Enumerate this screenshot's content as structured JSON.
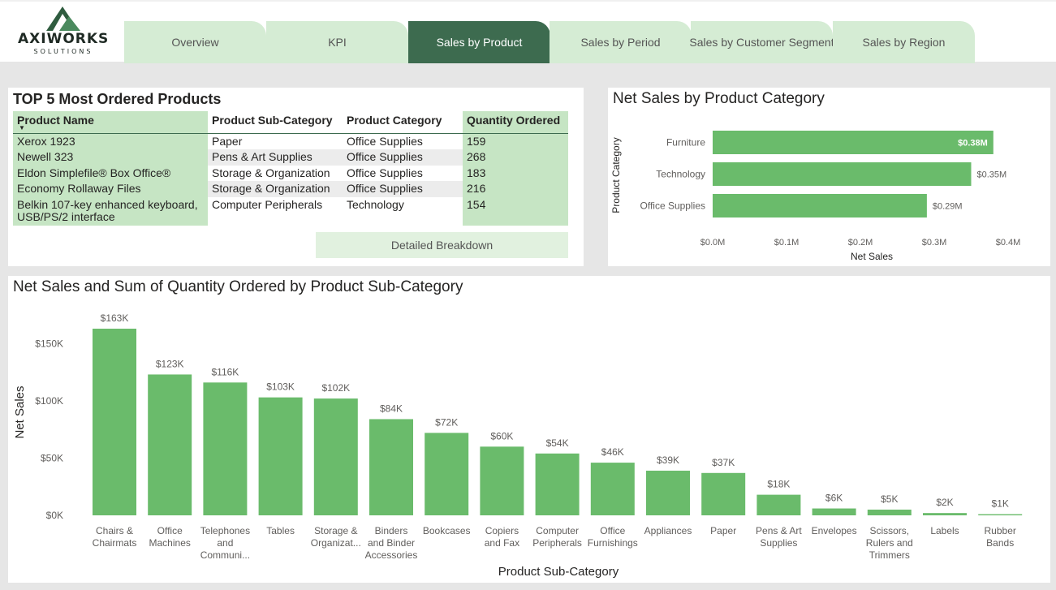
{
  "brand": {
    "name": "AXIWORKS",
    "sub": "SOLUTIONS"
  },
  "tabs": [
    {
      "label": "Overview"
    },
    {
      "label": "KPI"
    },
    {
      "label": "Sales by Product"
    },
    {
      "label": "Sales by Period"
    },
    {
      "label": "Sales by Customer Segment"
    },
    {
      "label": "Sales by Region"
    }
  ],
  "active_tab": "Sales by Product",
  "top_products": {
    "title": "TOP 5 Most Ordered Products",
    "columns": [
      "Product Name",
      "Product Sub-Category",
      "Product Category",
      "Quantity Ordered"
    ],
    "rows": [
      [
        "Xerox 1923",
        "Paper",
        "Office Supplies",
        "159"
      ],
      [
        "Newell 323",
        "Pens & Art Supplies",
        "Office Supplies",
        "268"
      ],
      [
        "Eldon Simplefile® Box Office®",
        "Storage & Organization",
        "Office Supplies",
        "183"
      ],
      [
        "Economy Rollaway Files",
        "Storage & Organization",
        "Office Supplies",
        "216"
      ],
      [
        "Belkin 107-key enhanced keyboard, USB/PS/2 interface",
        "Computer Peripherals",
        "Technology",
        "154"
      ]
    ],
    "button_label": "Detailed Breakdown"
  },
  "chart_data": [
    {
      "type": "bar",
      "orientation": "horizontal",
      "title": "Net Sales by Product Category",
      "categories": [
        "Furniture",
        "Technology",
        "Office Supplies"
      ],
      "values": [
        0.38,
        0.35,
        0.29
      ],
      "data_labels": [
        "$0.38M",
        "$0.35M",
        "$0.29M"
      ],
      "xlabel": "Net Sales",
      "ylabel": "Product Category",
      "xticks": [
        "$0.0M",
        "$0.1M",
        "$0.2M",
        "$0.3M",
        "$0.4M"
      ],
      "xlim": [
        0,
        0.4
      ],
      "bar_color": "#6abb6b"
    },
    {
      "type": "bar",
      "title": "Net Sales and Sum of Quantity Ordered by Product Sub-Category",
      "categories": [
        [
          "Chairs &",
          "Chairmats"
        ],
        [
          "Office",
          "Machines"
        ],
        [
          "Telephones",
          "and",
          "Communi..."
        ],
        [
          "Tables"
        ],
        [
          "Storage &",
          "Organizat..."
        ],
        [
          "Binders",
          "and Binder",
          "Accessories"
        ],
        [
          "Bookcases"
        ],
        [
          "Copiers",
          "and Fax"
        ],
        [
          "Computer",
          "Peripherals"
        ],
        [
          "Office",
          "Furnishings"
        ],
        [
          "Appliances"
        ],
        [
          "Paper"
        ],
        [
          "Pens & Art",
          "Supplies"
        ],
        [
          "Envelopes"
        ],
        [
          "Scissors,",
          "Rulers and",
          "Trimmers"
        ],
        [
          "Labels"
        ],
        [
          "Rubber",
          "Bands"
        ]
      ],
      "values": [
        163,
        123,
        116,
        103,
        102,
        84,
        72,
        60,
        54,
        46,
        39,
        37,
        18,
        6,
        5,
        2,
        1
      ],
      "data_labels": [
        "$163K",
        "$123K",
        "$116K",
        "$103K",
        "$102K",
        "$84K",
        "$72K",
        "$60K",
        "$54K",
        "$46K",
        "$39K",
        "$37K",
        "$18K",
        "$6K",
        "$5K",
        "$2K",
        "$1K"
      ],
      "value_unit": "thousands USD",
      "xlabel": "Product Sub-Category",
      "ylabel": "Net Sales",
      "yticks": [
        "$0K",
        "$50K",
        "$100K",
        "$150K"
      ],
      "ylim": [
        0,
        163
      ],
      "bar_color": "#6abb6b"
    }
  ]
}
